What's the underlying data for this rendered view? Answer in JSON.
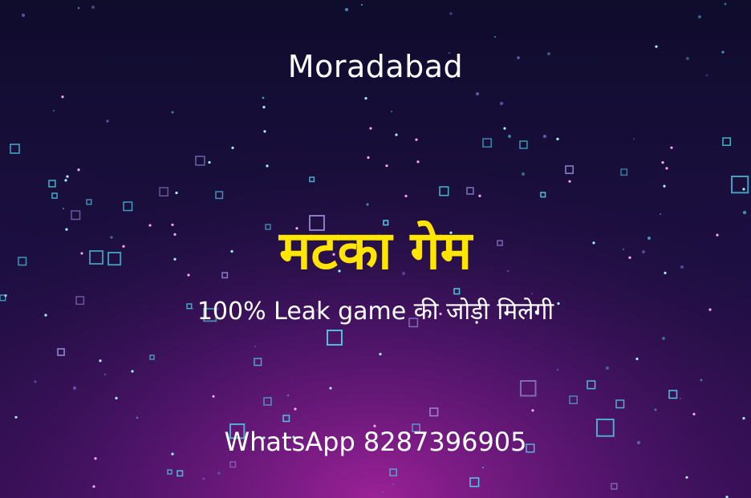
{
  "city": "Moradabad",
  "headline": "मटका गेम",
  "tagline": "100% Leak game की जोड़ी मिलेगी",
  "contact": "WhatsApp 8287396905",
  "colors": {
    "text_white": "#ffffff",
    "headline_yellow": "#ffe600",
    "bg_dark": "#0e0b2a",
    "bg_purple": "#3a0f5c",
    "bg_magenta": "#8a1a8a",
    "rain_cyan": "#37c6d8",
    "rain_pink": "#d24fd0",
    "square_cyan": "#4fd2e6"
  },
  "icons": [
    "falling-light-streak-icon",
    "square-outline-icon",
    "glow-dot-icon"
  ]
}
